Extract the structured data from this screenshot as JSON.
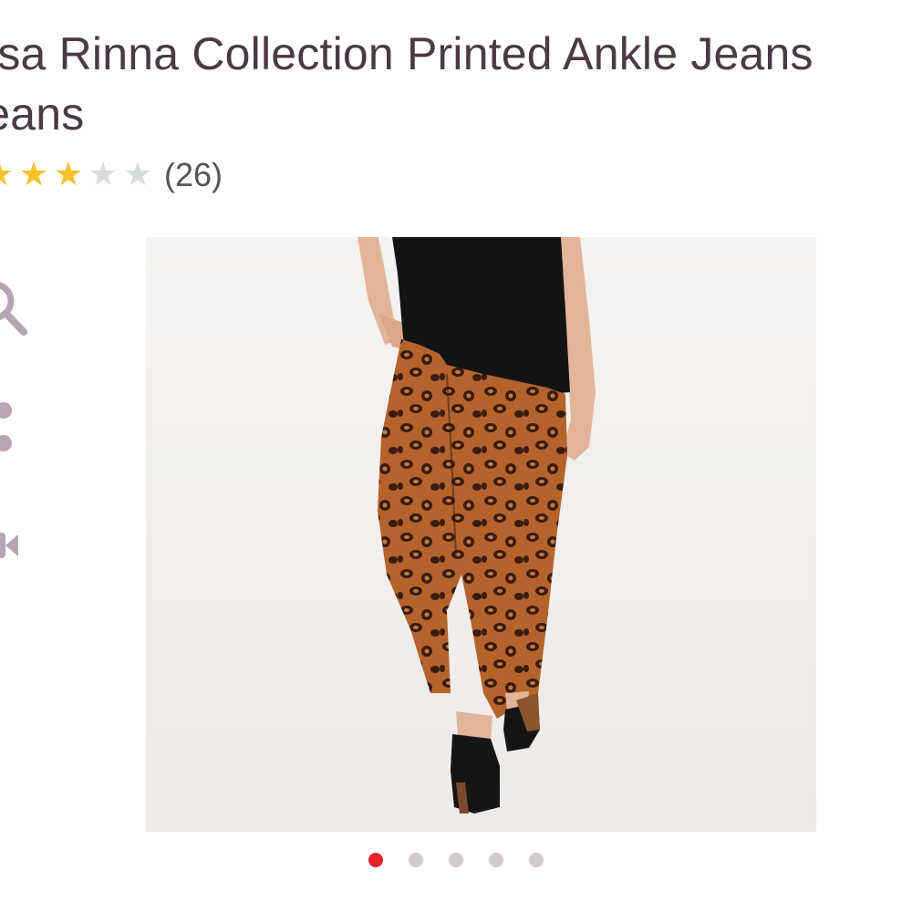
{
  "product": {
    "title": "Lisa Rinna Collection Printed Ankle Jeans\nJeans"
  },
  "rating": {
    "stars_filled": 3,
    "stars_total": 5,
    "review_count": "(26)"
  },
  "side_actions": {
    "zoom": "search-icon",
    "share": "share-icon",
    "video": "video-icon"
  },
  "image": {
    "alt": "Leopard print ankle jeans"
  },
  "carousel": {
    "slides": 5,
    "active": 0
  },
  "colors": {
    "title": "#4b3946",
    "star_filled": "#f6c12b",
    "star_empty": "#d5dde2",
    "icon": "#b7a4b4",
    "dot_active": "#e5222d",
    "dot_inactive": "#d3c7d2"
  }
}
